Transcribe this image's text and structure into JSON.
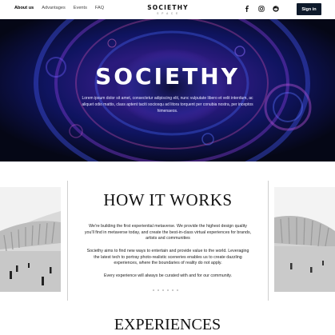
{
  "nav": {
    "links": [
      {
        "label": "About us",
        "active": true
      },
      {
        "label": "Advantages",
        "active": false
      },
      {
        "label": "Events",
        "active": false
      },
      {
        "label": "FAQ",
        "active": false
      }
    ],
    "brand": "SOCIETHY",
    "brand_sub": "S P A C E",
    "socials": [
      "facebook-icon",
      "instagram-icon",
      "reddit-icon"
    ],
    "sign_in": "Sign in",
    "button_color": "#0e1a2b"
  },
  "hero": {
    "title": "SOCIETHY",
    "text": "Lorem ipsum dolor sit amet, consectetur adipiscing elit, nunc vulputate libero et velit interdum, ac aliquet odio mattis, class aptent taciti sociosqu ad litora torquent per conubia nostra, per inceptos himenaeos."
  },
  "how": {
    "title": "HOW IT WORKS",
    "p1": "We're building the first experiential metaverse. We provide the highest design quality you'll find in metaverse today, and create the best-in-class virtual experiences for brands, artists and communities",
    "p2": "Societhy aims to find new ways to entertain and provide value to the world. Leveraging the latest tech to portray photo-realistic sceneries enables us to create dazzling experiences, where the boundaries of reality do not apply.",
    "p3": "Every experience will always be curated with and for our community."
  },
  "experiences": {
    "title": "EXPERIENCES"
  }
}
